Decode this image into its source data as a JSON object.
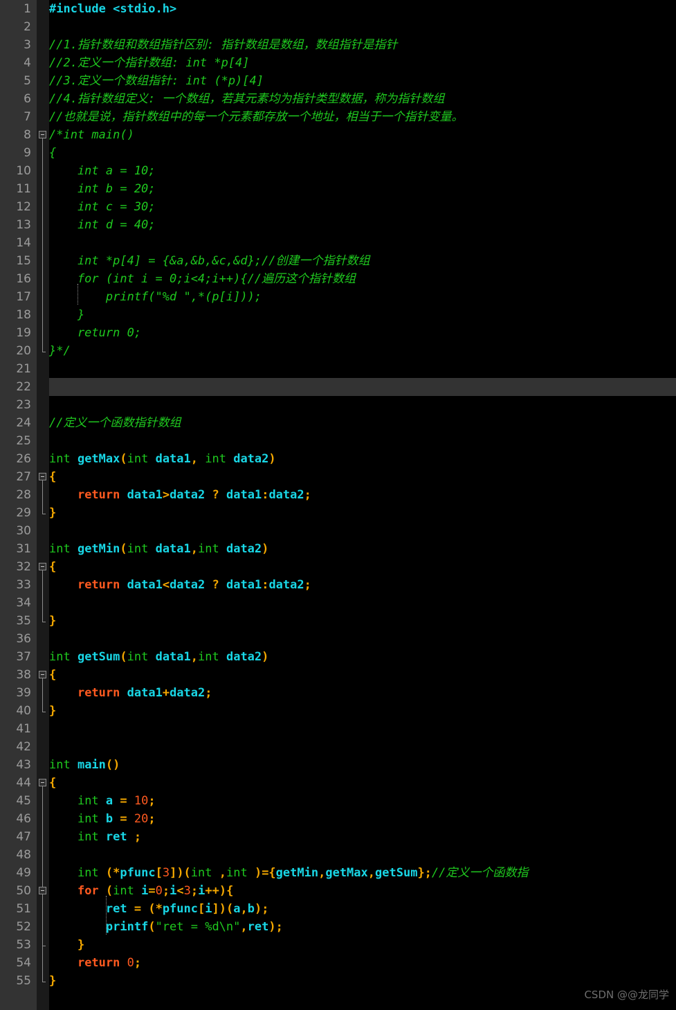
{
  "editor": {
    "colors": {
      "background": "#000000",
      "gutter_bg": "#333333",
      "fold_col_bg": "#1a1a1a",
      "line_number": "#9c9c9c",
      "current_line_highlight": "#333333",
      "cursor": "#ffffff",
      "comment": "#1fc91f",
      "keyword": "#1fc91f",
      "control": "#ff5a20",
      "function": "#19d7e6",
      "identifier": "#19d7e6",
      "punctuation": "#f5a800",
      "number": "#ff5a20",
      "string": "#1fc91f",
      "preprocessor": "#19d7e6"
    },
    "cursor_line": 22,
    "total_lines": 55,
    "line_numbers": [
      1,
      2,
      3,
      4,
      5,
      6,
      7,
      8,
      9,
      10,
      11,
      12,
      13,
      14,
      15,
      16,
      17,
      18,
      19,
      20,
      21,
      22,
      23,
      24,
      25,
      26,
      27,
      28,
      29,
      30,
      31,
      32,
      33,
      34,
      35,
      36,
      37,
      38,
      39,
      40,
      41,
      42,
      43,
      44,
      45,
      46,
      47,
      48,
      49,
      50,
      51,
      52,
      53,
      54,
      55
    ]
  },
  "lines": {
    "1": "#include <stdio.h>",
    "2": "",
    "3": "//1.指针数组和数组指针区别: 指针数组是数组，数组指针是指针",
    "4": "//2.定义一个指针数组: int *p[4]",
    "5": "//3.定义一个数组指针: int (*p)[4]",
    "6": "//4.指针数组定义: 一个数组，若其元素均为指针类型数据，称为指针数组",
    "7": "//也就是说，指针数组中的每一个元素都存放一个地址，相当于一个指针变量。",
    "8": "/*int main()",
    "9": "{",
    "10": "    int a = 10;",
    "11": "    int b = 20;",
    "12": "    int c = 30;",
    "13": "    int d = 40;",
    "14": "",
    "15": "    int *p[4] = {&a,&b,&c,&d};//创建一个指针数组",
    "16": "    for (int i = 0;i<4;i++){//遍历这个指针数组",
    "17": "        printf(\"%d \",*(p[i]));",
    "18": "    }",
    "19": "    return 0;",
    "20": "}*/",
    "21": "",
    "22": "",
    "23": "",
    "24": "//定义一个函数指针数组",
    "25": "",
    "26": "int getMax(int data1, int data2)",
    "27": "{",
    "28": "    return data1>data2 ? data1:data2;",
    "29": "}",
    "30": "",
    "31": "int getMin(int data1,int data2)",
    "32": "{",
    "33": "    return data1<data2 ? data1:data2;",
    "34": "",
    "35": "}",
    "36": "",
    "37": "int getSum(int data1,int data2)",
    "38": "{",
    "39": "    return data1+data2;",
    "40": "}",
    "41": "",
    "42": "",
    "43": "int main()",
    "44": "{",
    "45": "    int a = 10;",
    "46": "    int b = 20;",
    "47": "    int ret ;",
    "48": "",
    "49": "    int (*pfunc[3])(int ,int )={getMin,getMax,getSum};//定义一个函数指",
    "50": "    for (int i=0;i<3;i++){",
    "51": "        ret = (*pfunc[i])(a,b);",
    "52": "        printf(\"ret = %d\\n\",ret);",
    "53": "    }",
    "54": "    return 0;",
    "55": "}"
  },
  "tokens": {
    "1": [
      [
        "#include <stdio.h>",
        "t-pre"
      ]
    ],
    "3": [
      [
        "//1.指针数组和数组指针区别: 指针数组是数组，数组指针是指针",
        "t-cmt"
      ]
    ],
    "4": [
      [
        "//2.定义一个指针数组: int *p[4]",
        "t-cmt"
      ]
    ],
    "5": [
      [
        "//3.定义一个数组指针: int (*p)[4]",
        "t-cmt"
      ]
    ],
    "6": [
      [
        "//4.指针数组定义: 一个数组，若其元素均为指针类型数据，称为指针数组",
        "t-cmt"
      ]
    ],
    "7": [
      [
        "//也就是说，指针数组中的每一个元素都存放一个地址，相当于一个指针变量。",
        "t-cmt"
      ]
    ],
    "8": [
      [
        "/*int main()",
        "blk"
      ]
    ],
    "9": [
      [
        "{",
        "blk"
      ]
    ],
    "10": [
      [
        "    int a = 10;",
        "blk"
      ]
    ],
    "11": [
      [
        "    int b = 20;",
        "blk"
      ]
    ],
    "12": [
      [
        "    int c = 30;",
        "blk"
      ]
    ],
    "13": [
      [
        "    int d = 40;",
        "blk"
      ]
    ],
    "15": [
      [
        "    int *p[4] = {&a,&b,&c,&d};//创建一个指针数组",
        "blk"
      ]
    ],
    "16": [
      [
        "    for (int i = 0;i<4;i++){//遍历这个指针数组",
        "blk"
      ]
    ],
    "17": [
      [
        "        printf(\"%d \",*(p[i]));",
        "blk"
      ]
    ],
    "18": [
      [
        "    }",
        "blk"
      ]
    ],
    "19": [
      [
        "    return 0;",
        "blk"
      ]
    ],
    "20": [
      [
        "}*/",
        "blk"
      ]
    ],
    "24": [
      [
        "//定义一个函数指针数组",
        "t-cmt"
      ]
    ],
    "26": [
      [
        "int ",
        "t-kw"
      ],
      [
        "getMax",
        "t-fn"
      ],
      [
        "(",
        "t-pun"
      ],
      [
        "int ",
        "t-kw"
      ],
      [
        "data1",
        "t-id"
      ],
      [
        ", ",
        "t-pun"
      ],
      [
        "int ",
        "t-kw"
      ],
      [
        "data2",
        "t-id"
      ],
      [
        ")",
        "t-pun"
      ]
    ],
    "27": [
      [
        "{",
        "t-pun"
      ]
    ],
    "28": [
      [
        "    ",
        " "
      ],
      [
        "return",
        "t-ctl"
      ],
      [
        " ",
        "t-pun"
      ],
      [
        "data1",
        "t-id"
      ],
      [
        ">",
        "t-pun"
      ],
      [
        "data2",
        "t-id"
      ],
      [
        " ",
        "t-pun"
      ],
      [
        "?",
        "t-pun"
      ],
      [
        " ",
        "t-pun"
      ],
      [
        "data1",
        "t-id"
      ],
      [
        ":",
        "t-pun"
      ],
      [
        "data2",
        "t-id"
      ],
      [
        ";",
        "t-pun"
      ]
    ],
    "29": [
      [
        "}",
        "t-pun"
      ]
    ],
    "31": [
      [
        "int ",
        "t-kw"
      ],
      [
        "getMin",
        "t-fn"
      ],
      [
        "(",
        "t-pun"
      ],
      [
        "int ",
        "t-kw"
      ],
      [
        "data1",
        "t-id"
      ],
      [
        ",",
        "t-pun"
      ],
      [
        "int ",
        "t-kw"
      ],
      [
        "data2",
        "t-id"
      ],
      [
        ")",
        "t-pun"
      ]
    ],
    "32": [
      [
        "{",
        "t-pun"
      ]
    ],
    "33": [
      [
        "    ",
        " "
      ],
      [
        "return",
        "t-ctl"
      ],
      [
        " ",
        "t-pun"
      ],
      [
        "data1",
        "t-id"
      ],
      [
        "<",
        "t-pun"
      ],
      [
        "data2",
        "t-id"
      ],
      [
        " ",
        "t-pun"
      ],
      [
        "?",
        "t-pun"
      ],
      [
        " ",
        "t-pun"
      ],
      [
        "data1",
        "t-id"
      ],
      [
        ":",
        "t-pun"
      ],
      [
        "data2",
        "t-id"
      ],
      [
        ";",
        "t-pun"
      ]
    ],
    "35": [
      [
        "}",
        "t-pun"
      ]
    ],
    "37": [
      [
        "int ",
        "t-kw"
      ],
      [
        "getSum",
        "t-fn"
      ],
      [
        "(",
        "t-pun"
      ],
      [
        "int ",
        "t-kw"
      ],
      [
        "data1",
        "t-id"
      ],
      [
        ",",
        "t-pun"
      ],
      [
        "int ",
        "t-kw"
      ],
      [
        "data2",
        "t-id"
      ],
      [
        ")",
        "t-pun"
      ]
    ],
    "38": [
      [
        "{",
        "t-pun"
      ]
    ],
    "39": [
      [
        "    ",
        " "
      ],
      [
        "return",
        "t-ctl"
      ],
      [
        " ",
        "t-pun"
      ],
      [
        "data1",
        "t-id"
      ],
      [
        "+",
        "t-pun"
      ],
      [
        "data2",
        "t-id"
      ],
      [
        ";",
        "t-pun"
      ]
    ],
    "40": [
      [
        "}",
        "t-pun"
      ]
    ],
    "43": [
      [
        "int ",
        "t-kw"
      ],
      [
        "main",
        "t-fn"
      ],
      [
        "()",
        "t-pun"
      ]
    ],
    "44": [
      [
        "{",
        "t-pun"
      ]
    ],
    "45": [
      [
        "    ",
        "t-pun"
      ],
      [
        "int ",
        "t-kw"
      ],
      [
        "a",
        "t-id"
      ],
      [
        " = ",
        "t-pun"
      ],
      [
        "10",
        "t-num"
      ],
      [
        ";",
        "t-pun"
      ]
    ],
    "46": [
      [
        "    ",
        "t-pun"
      ],
      [
        "int ",
        "t-kw"
      ],
      [
        "b",
        "t-id"
      ],
      [
        " = ",
        "t-pun"
      ],
      [
        "20",
        "t-num"
      ],
      [
        ";",
        "t-pun"
      ]
    ],
    "47": [
      [
        "    ",
        "t-pun"
      ],
      [
        "int ",
        "t-kw"
      ],
      [
        "ret",
        "t-id"
      ],
      [
        " ;",
        "t-pun"
      ]
    ],
    "49": [
      [
        "    ",
        "t-pun"
      ],
      [
        "int ",
        "t-kw"
      ],
      [
        "(*",
        "t-pun"
      ],
      [
        "pfunc",
        "t-id"
      ],
      [
        "[",
        "t-pun"
      ],
      [
        "3",
        "t-num"
      ],
      [
        "])(",
        "t-pun"
      ],
      [
        "int ",
        "t-kw"
      ],
      [
        ",",
        "t-pun"
      ],
      [
        "int ",
        "t-kw"
      ],
      [
        ")={",
        "t-pun"
      ],
      [
        "getMin",
        "t-fn"
      ],
      [
        ",",
        "t-pun"
      ],
      [
        "getMax",
        "t-fn"
      ],
      [
        ",",
        "t-pun"
      ],
      [
        "getSum",
        "t-fn"
      ],
      [
        "};",
        "t-pun"
      ],
      [
        "//定义一个函数指",
        "t-cmt"
      ]
    ],
    "50": [
      [
        "    ",
        "t-pun"
      ],
      [
        "for",
        "t-ctl"
      ],
      [
        " ",
        "t-pun"
      ],
      [
        "(",
        "t-pun"
      ],
      [
        "int ",
        "t-kw"
      ],
      [
        "i",
        "t-id"
      ],
      [
        "=",
        "t-pun"
      ],
      [
        "0",
        "t-num"
      ],
      [
        ";",
        "t-pun"
      ],
      [
        "i",
        "t-id"
      ],
      [
        "<",
        "t-pun"
      ],
      [
        "3",
        "t-num"
      ],
      [
        ";",
        "t-pun"
      ],
      [
        "i",
        "t-id"
      ],
      [
        "++){",
        "t-pun"
      ]
    ],
    "51": [
      [
        "        ",
        "t-pun"
      ],
      [
        "ret",
        "t-id"
      ],
      [
        " = ",
        "t-pun"
      ],
      [
        "(*",
        "t-pun"
      ],
      [
        "pfunc",
        "t-id"
      ],
      [
        "[",
        "t-pun"
      ],
      [
        "i",
        "t-id"
      ],
      [
        "])(",
        "t-pun"
      ],
      [
        "a",
        "t-id"
      ],
      [
        ",",
        "t-pun"
      ],
      [
        "b",
        "t-id"
      ],
      [
        ");",
        "t-pun"
      ]
    ],
    "52": [
      [
        "        ",
        "t-pun"
      ],
      [
        "printf",
        "t-fn"
      ],
      [
        "(",
        "t-pun"
      ],
      [
        "\"ret = %d\\n\"",
        "t-str"
      ],
      [
        ",",
        "t-pun"
      ],
      [
        "ret",
        "t-id"
      ],
      [
        ");",
        "t-pun"
      ]
    ],
    "53": [
      [
        "    }",
        "t-pun"
      ]
    ],
    "54": [
      [
        "    ",
        "t-pun"
      ],
      [
        "return",
        "t-ctl"
      ],
      [
        " ",
        "t-pun"
      ],
      [
        "0",
        "t-num"
      ],
      [
        ";",
        "t-pun"
      ]
    ],
    "55": [
      [
        "}",
        "t-pun"
      ]
    ]
  },
  "fold_markers": [
    {
      "line": 8,
      "type": "start"
    },
    {
      "line": 27,
      "type": "start"
    },
    {
      "line": 32,
      "type": "start"
    },
    {
      "line": 38,
      "type": "start"
    },
    {
      "line": 44,
      "type": "start"
    },
    {
      "line": 50,
      "type": "start"
    }
  ],
  "fold_regions": [
    {
      "from": 8,
      "to": 20
    },
    {
      "from": 27,
      "to": 29
    },
    {
      "from": 32,
      "to": 35
    },
    {
      "from": 38,
      "to": 40
    },
    {
      "from": 44,
      "to": 55
    },
    {
      "from": 50,
      "to": 53
    }
  ],
  "indent_guides": [
    {
      "from": 17,
      "to": 17,
      "indent": 1
    },
    {
      "from": 51,
      "to": 52,
      "indent": 2
    }
  ],
  "watermark": {
    "text": "CSDN @@龙同学"
  }
}
